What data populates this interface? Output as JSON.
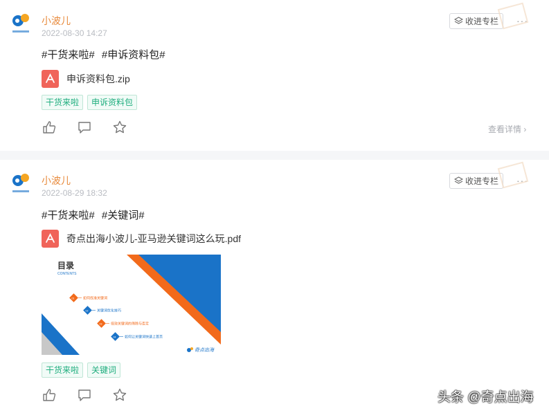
{
  "posts": [
    {
      "author": "小波儿",
      "date": "2022-08-30 14:27",
      "collect_label": "收进专栏",
      "more_label": "···",
      "hashtags": [
        "#干货来啦#",
        "#申诉资料包#"
      ],
      "attachment": {
        "name": "申诉资料包.zip",
        "icon": "file-pdf-icon"
      },
      "tags": [
        "干货来啦",
        "申诉资料包"
      ],
      "detail_link": "查看详情",
      "actions": [
        "like-icon",
        "comment-icon",
        "star-icon"
      ]
    },
    {
      "author": "小波儿",
      "date": "2022-08-29 18:32",
      "collect_label": "收进专栏",
      "more_label": "···",
      "hashtags": [
        "#干货来啦#",
        "#关键词#"
      ],
      "attachment": {
        "name": "奇点出海小波儿-亚马逊关键词这么玩.pdf",
        "icon": "file-pdf-icon"
      },
      "preview": {
        "title": "目录",
        "subtitle": "CONTENTS",
        "items": [
          "如何找准关键词",
          "关键词优化技巧",
          "低效关键词的筛除与否定",
          "如何让关键词快速上首页"
        ],
        "numbers": [
          "01",
          "02",
          "03",
          "04"
        ],
        "brand": "奇点出海"
      },
      "tags": [
        "干货来啦",
        "关键词"
      ],
      "actions": [
        "like-icon",
        "comment-icon",
        "star-icon"
      ]
    }
  ],
  "footer_watermark": "头条 @奇点出海",
  "colors": {
    "author": "#e88a3c",
    "tag_text": "#1fae7e",
    "pdf_red": "#f0645a",
    "accent_blue": "#1a73c8",
    "accent_orange": "#f26a1b"
  }
}
